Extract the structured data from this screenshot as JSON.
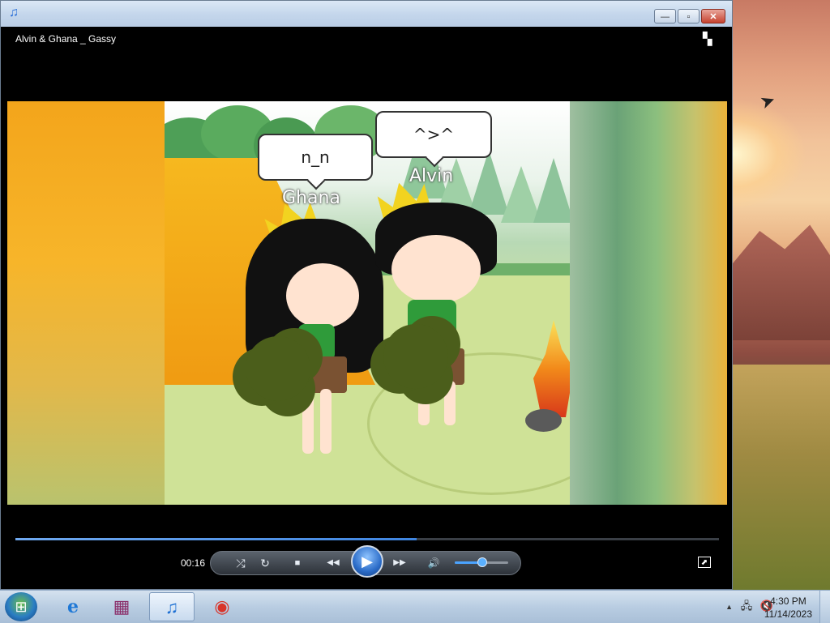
{
  "window": {
    "title": "Alvin & Ghana _ Gassy",
    "app_icon": "music-note-icon",
    "minimize_glyph": "—",
    "maximize_glyph": "▫",
    "close_glyph": "✕"
  },
  "video": {
    "bubble_ghana": "n_n",
    "bubble_alvin": "^>^",
    "name_ghana": "Ghana",
    "name_alvin": "Alvin"
  },
  "player": {
    "current_time": "00:16",
    "progress_fraction": 0.57,
    "volume_fraction": 0.5,
    "controls": {
      "shuffle": "⤮",
      "repeat": "↻",
      "stop": "■",
      "previous": "◀◀",
      "play": "▶",
      "next": "▶▶",
      "mute": "🔊",
      "fullscreen": "⬈"
    }
  },
  "taskbar": {
    "start_glyph": "⊞",
    "items": [
      {
        "name": "internet-explorer",
        "glyph": "e"
      },
      {
        "name": "winrar",
        "glyph": "▦"
      },
      {
        "name": "windows-media-player",
        "glyph": "♫"
      },
      {
        "name": "chrome",
        "glyph": "◉"
      }
    ],
    "tray_up_arrow": "▲",
    "tray_network": "🖧",
    "tray_volume_muted": "🔇",
    "time": "4:30 PM",
    "date": "11/14/2023"
  },
  "colors": {
    "seek_fill": "#3f85e0",
    "titlebar": "#c5d7ec",
    "taskbar": "#b9cde2"
  }
}
